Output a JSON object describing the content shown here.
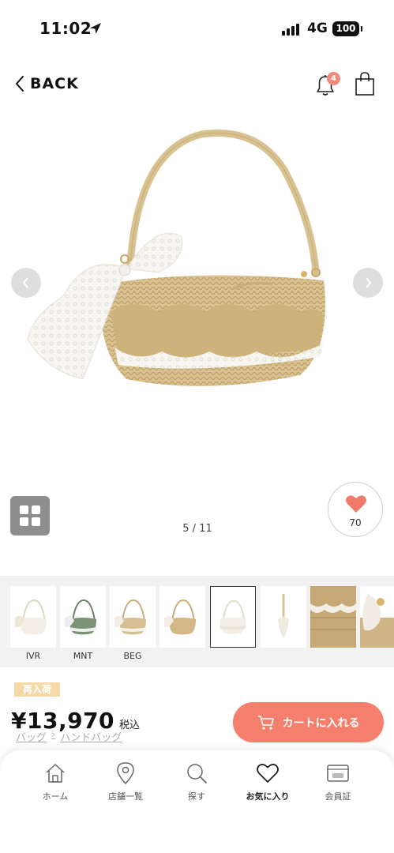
{
  "status_bar": {
    "time": "11:02",
    "network": "4G",
    "battery": "100"
  },
  "header": {
    "back_label": "BACK",
    "notification_count": "4"
  },
  "gallery": {
    "page_indicator": "5 / 11",
    "favorite_count": "70"
  },
  "thumbnails": [
    {
      "label": "IVR",
      "variant": "ivory"
    },
    {
      "label": "MNT",
      "variant": "mint"
    },
    {
      "label": "BEG",
      "variant": "beige"
    },
    {
      "label": "",
      "variant": "beige"
    },
    {
      "label": "",
      "variant": "detail-lace",
      "selected": true
    },
    {
      "label": "",
      "variant": "detail-bow"
    },
    {
      "label": "",
      "variant": "detail-weave"
    },
    {
      "label": "",
      "variant": "detail-tassel"
    }
  ],
  "product": {
    "restock_badge": "再入荷",
    "price": "¥13,970",
    "tax_label": "税込",
    "breadcrumb": [
      "バッグ",
      "ハンドバッグ"
    ],
    "cart_button_label": "カートに入れる"
  },
  "tab_bar": {
    "items": [
      {
        "label": "ホーム",
        "icon": "home-icon"
      },
      {
        "label": "店舗一覧",
        "icon": "map-pin-icon"
      },
      {
        "label": "探す",
        "icon": "search-icon"
      },
      {
        "label": "お気に入り",
        "icon": "heart-icon",
        "active": true
      },
      {
        "label": "会員証",
        "icon": "member-card-icon"
      }
    ]
  },
  "colors": {
    "accent": "#f57f6d",
    "heart": "#f07a6a",
    "badge": "#f08a7a",
    "restock": "#f5d9a8"
  }
}
